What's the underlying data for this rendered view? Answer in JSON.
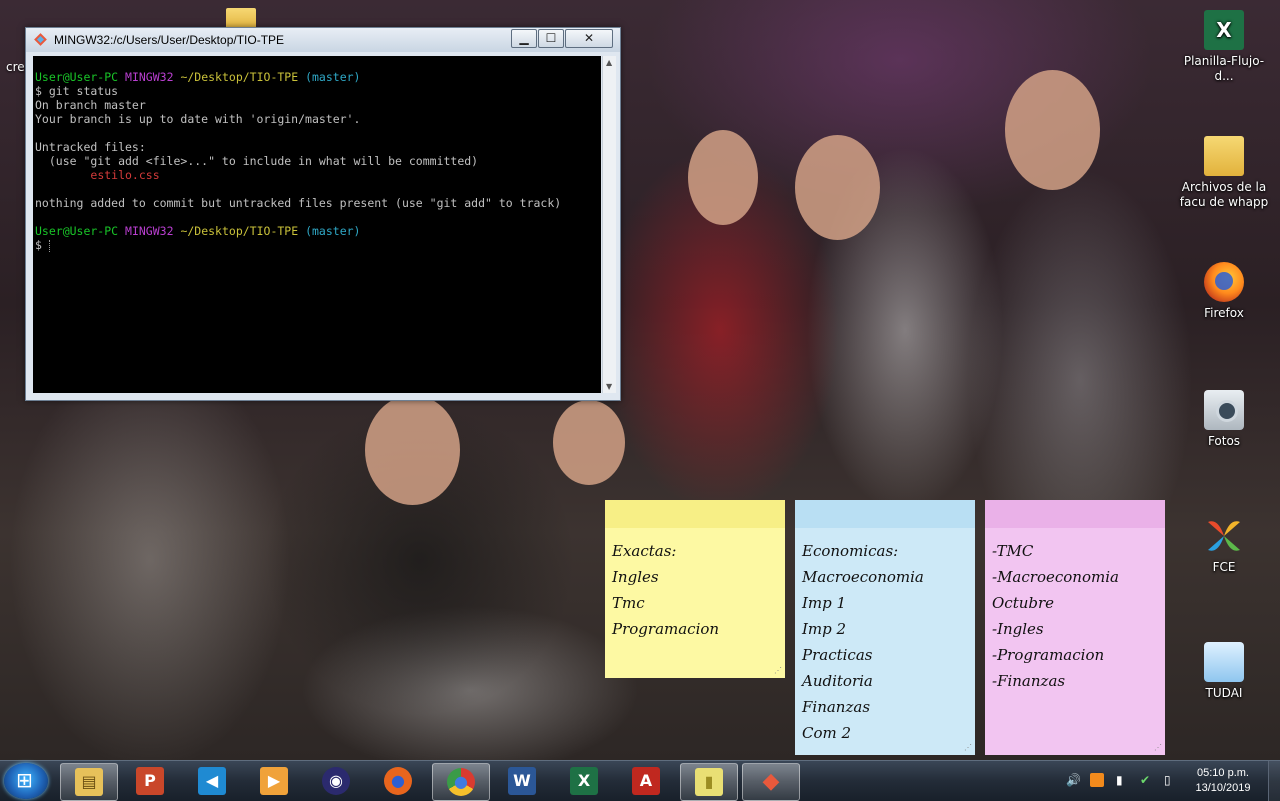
{
  "desktop": {
    "icons": [
      {
        "label": "Planilla-Flujo-d...",
        "icon": "excel-file-icon"
      },
      {
        "label": "Archivos de la facu de whapp",
        "icon": "folder-icon"
      },
      {
        "label": "Firefox",
        "icon": "firefox-icon"
      },
      {
        "label": "Fotos",
        "icon": "photos-camera-icon"
      },
      {
        "label": "FCE",
        "icon": "fce-icon"
      },
      {
        "label": "TUDAI",
        "icon": "tudai-icon"
      }
    ],
    "partial_left_label": "crea"
  },
  "terminal": {
    "title": "MINGW32:/c/Users/User/Desktop/TIO-TPE",
    "controls": {
      "minimize": "▁",
      "maximize": "☐",
      "close": "✕"
    },
    "prompt1": {
      "user": "User@User-PC",
      "shell": "MINGW32",
      "path": "~/Desktop/TIO-TPE",
      "branch": "(master)"
    },
    "cmd": "$ git status",
    "out1": "On branch master",
    "out2": "Your branch is up to date with 'origin/master'.",
    "out3": "Untracked files:",
    "out4": "  (use \"git add <file>...\" to include in what will be committed)",
    "untracked": "estilo.css",
    "out5": "nothing added to commit but untracked files present (use \"git add\" to track)",
    "prompt2": {
      "user": "User@User-PC",
      "shell": "MINGW32",
      "path": "~/Desktop/TIO-TPE",
      "branch": "(master)"
    },
    "prompt_symbol": "$"
  },
  "notes": {
    "yellow": [
      "Exactas:",
      "Ingles",
      "Tmc",
      "Programacion"
    ],
    "blue": [
      "Economicas:",
      "Macroeconomia",
      "Imp 1",
      "Imp 2",
      "Practicas",
      "Auditoria",
      "Finanzas",
      "Com 2"
    ],
    "pink": [
      "-TMC",
      "-Macroeconomia",
      "Octubre",
      "-Ingles",
      "-Programacion",
      "-Finanzas"
    ]
  },
  "taskbar": {
    "apps": [
      {
        "name": "file-explorer",
        "glyph": "▤",
        "color": "#e7c15a"
      },
      {
        "name": "powerpoint",
        "glyph": "P",
        "color": "#c9472a"
      },
      {
        "name": "visual-studio-code",
        "glyph": "◀",
        "color": "#1f8ad2"
      },
      {
        "name": "media-player",
        "glyph": "▶",
        "color": "#f0a23a"
      },
      {
        "name": "eclipse",
        "glyph": "◉",
        "color": "#2b2a6e"
      },
      {
        "name": "firefox",
        "glyph": "●",
        "color": "#e8651d"
      },
      {
        "name": "chrome",
        "glyph": "●",
        "color": "#3a9b47"
      },
      {
        "name": "word",
        "glyph": "W",
        "color": "#2b5797"
      },
      {
        "name": "excel",
        "glyph": "X",
        "color": "#1e7145"
      },
      {
        "name": "acrobat",
        "glyph": "A",
        "color": "#c0281f"
      },
      {
        "name": "sticky-notes",
        "glyph": "▮",
        "color": "#e9df74"
      },
      {
        "name": "git-bash",
        "glyph": "◆",
        "color": "#e9593c"
      }
    ],
    "tray": {
      "volume": "🔊",
      "signal": "▮",
      "battery": "▯"
    },
    "clock": {
      "time": "05:10 p.m.",
      "date": "13/10/2019"
    }
  }
}
